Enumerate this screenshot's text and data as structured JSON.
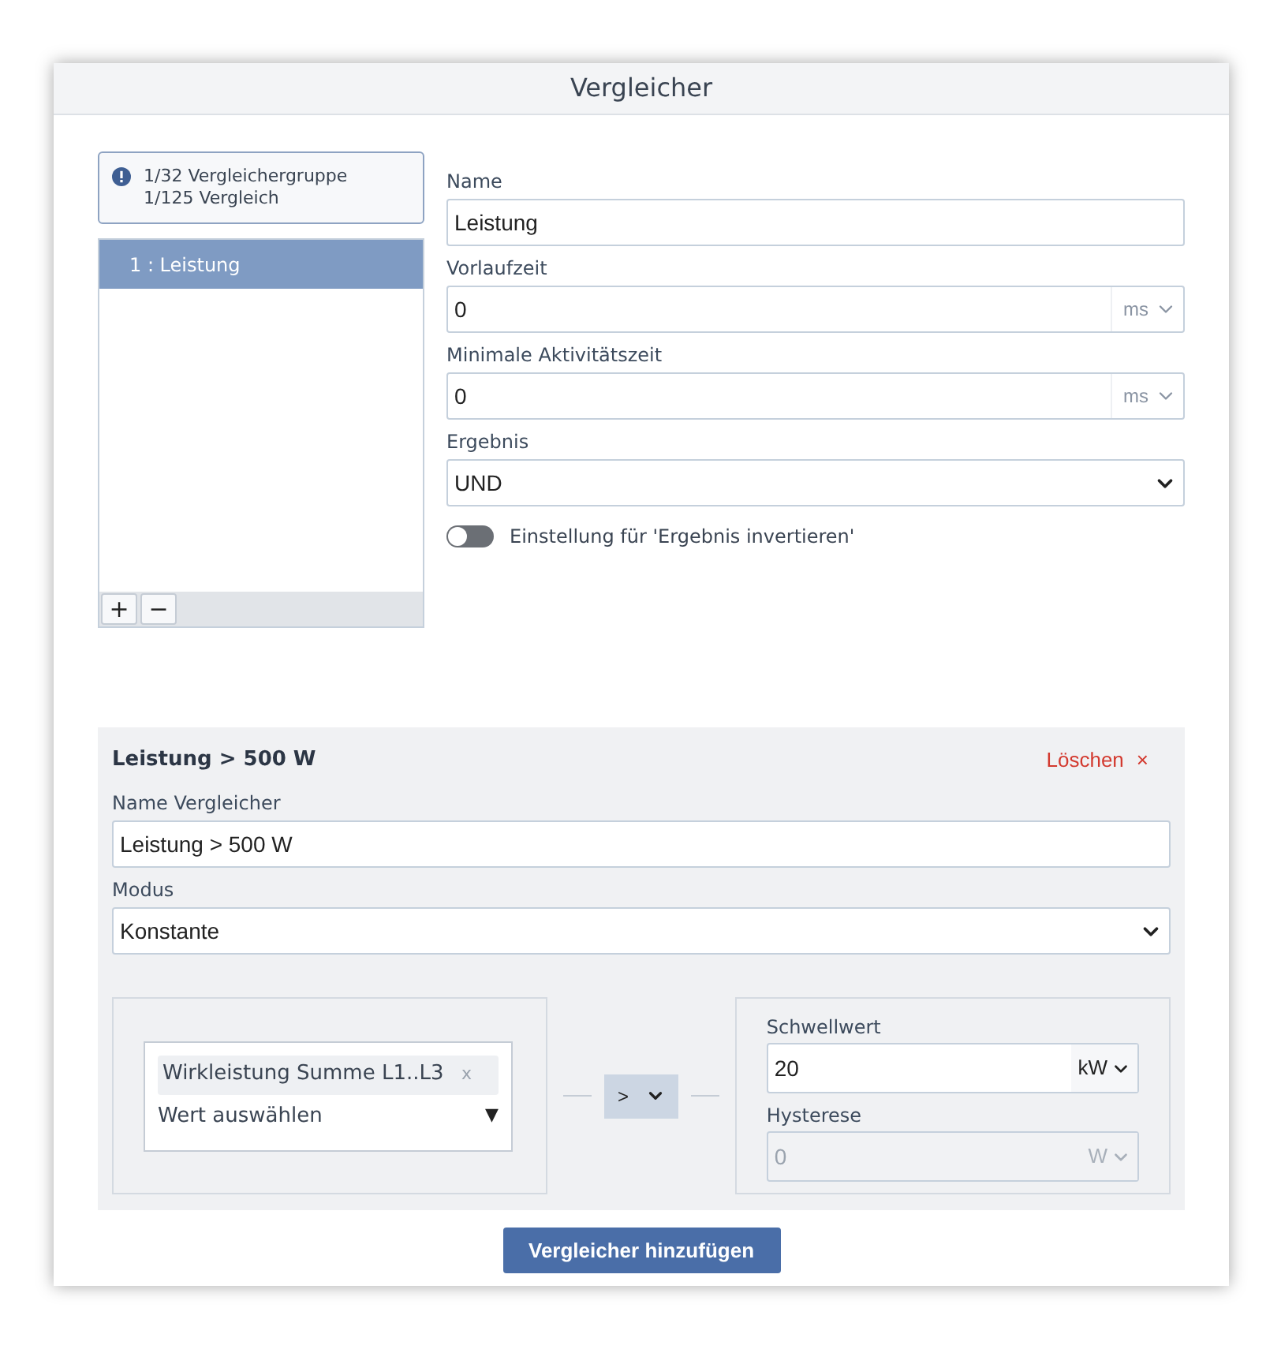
{
  "window": {
    "title": "Vergleicher"
  },
  "info": {
    "lines": [
      "1/32 Vergleichergruppe",
      "1/125 Vergleich"
    ]
  },
  "groups": [
    {
      "label": "1 : Leistung",
      "selected": true
    }
  ],
  "list_buttons": [
    "+",
    "−"
  ],
  "fields": [
    {
      "kind": "text",
      "label": "Name",
      "value": "Leistung"
    },
    {
      "kind": "unit",
      "label": "Vorlaufzeit",
      "value": "0",
      "unit": "ms"
    },
    {
      "kind": "unit",
      "label": "Minimale Aktivitätszeit",
      "value": "0",
      "unit": "ms"
    },
    {
      "kind": "select",
      "label": "Ergebnis",
      "value": "UND"
    }
  ],
  "invert_toggle": {
    "label": "Einstellung für 'Ergebnis invertieren'",
    "on": false
  },
  "comparator": {
    "title": "Leistung > 500 W",
    "delete": "Löschen",
    "delete_icon": "×",
    "fields": [
      {
        "kind": "text",
        "label": "Name Vergleicher",
        "value": "Leistung > 500 W"
      },
      {
        "kind": "select",
        "label": "Modus",
        "value": "Konstante"
      }
    ],
    "value_tag": "Wirkleistung Summe L1..L3",
    "tag_remove": "x",
    "value_placeholder": "Wert auswählen",
    "dropdown_arrow": "▼",
    "operator": ">",
    "threshold": {
      "label": "Schwellwert",
      "value": "20",
      "unit": "kW",
      "disabled": false
    },
    "hysteresis": {
      "label": "Hysterese",
      "value": "0",
      "unit": "W",
      "disabled": true
    }
  },
  "add_button": "Vergleicher hinzufügen"
}
